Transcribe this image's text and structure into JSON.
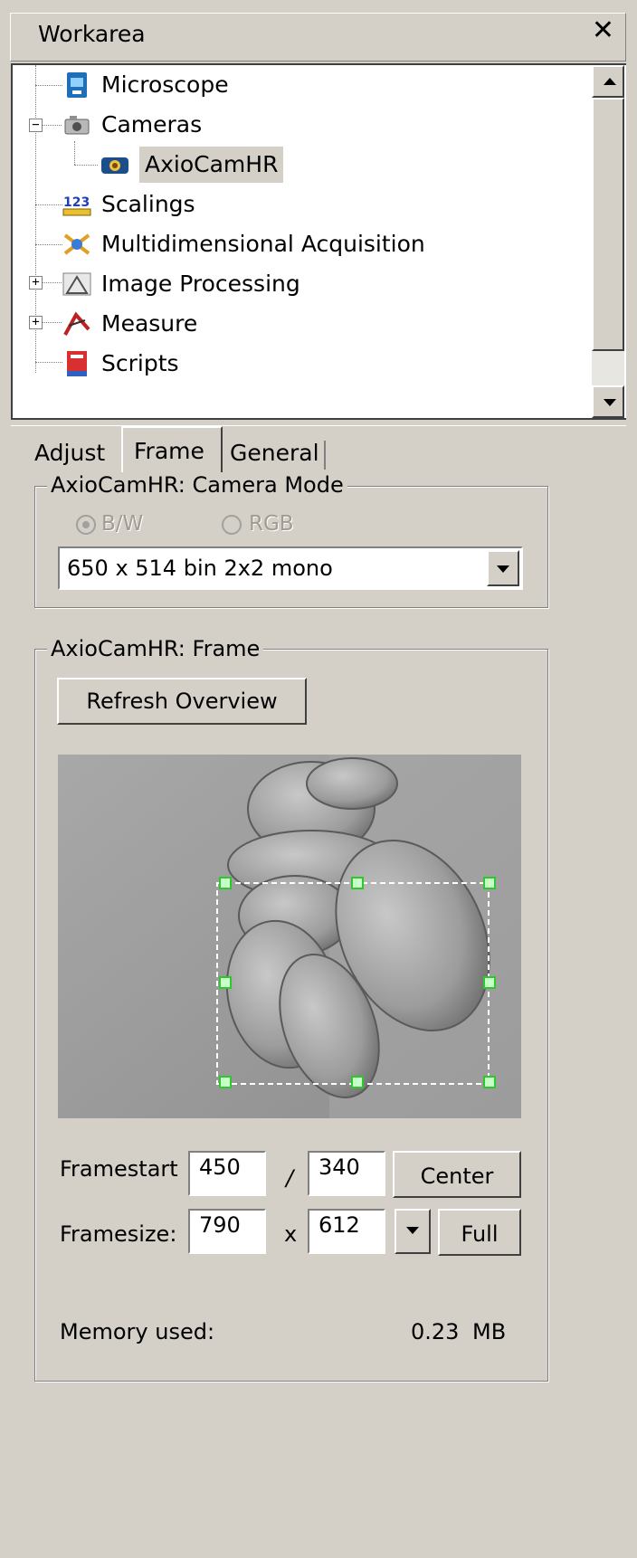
{
  "panel": {
    "title": "Workarea",
    "close_label": "✕"
  },
  "tree": {
    "items": [
      {
        "label": "Microscope",
        "icon": "microscope-icon"
      },
      {
        "label": "Cameras",
        "icon": "camera-icon",
        "expanded": true
      },
      {
        "label": "AxioCamHR",
        "icon": "axiocam-icon",
        "selected": true
      },
      {
        "label": "Scalings",
        "icon": "scalings-icon"
      },
      {
        "label": "Multidimensional Acquisition",
        "icon": "multidimensional-icon"
      },
      {
        "label": "Image Processing",
        "icon": "image-processing-icon",
        "expandable": true
      },
      {
        "label": "Measure",
        "icon": "measure-icon",
        "expandable": true
      },
      {
        "label": "Scripts",
        "icon": "scripts-icon"
      }
    ]
  },
  "tabs": [
    {
      "label": "Adjust"
    },
    {
      "label": "Frame",
      "active": true
    },
    {
      "label": "General"
    }
  ],
  "camera_mode": {
    "group_label": "AxioCamHR: Camera Mode",
    "radio_bw": "B/W",
    "radio_rgb": "RGB",
    "selected_mode": "B/W",
    "mode_value": "650 x 514 bin 2x2 mono"
  },
  "frame": {
    "group_label": "AxioCamHR: Frame",
    "refresh_label": "Refresh Overview",
    "framestart_label": "Framestart",
    "framestart_x": "450",
    "framestart_sep": "/",
    "framestart_y": "340",
    "center_label": "Center",
    "framesize_label": "Framesize:",
    "framesize_w": "790",
    "framesize_sep": "x",
    "framesize_h": "612",
    "full_label": "Full",
    "memory_label": "Memory used:",
    "memory_value": "0.23",
    "memory_unit": "MB"
  },
  "colors": {
    "background": "#d4d0c8",
    "selection_handles": "#2ec82e"
  }
}
